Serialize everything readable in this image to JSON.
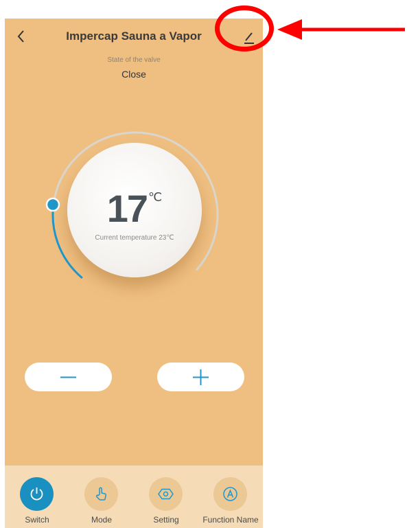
{
  "header": {
    "title": "Impercap Sauna a Vapor",
    "back_icon": "chevron-left-icon",
    "edit_icon": "pencil-icon"
  },
  "status": {
    "label": "State of the valve",
    "value": "Close"
  },
  "thermostat": {
    "set_temperature": "17",
    "unit": "℃",
    "current_temperature_text": "Current temperature 23℃",
    "accent_color": "#2196c9"
  },
  "controls": {
    "decrease_icon": "minus-icon",
    "increase_icon": "plus-icon"
  },
  "bottom_nav": {
    "items": [
      {
        "label": "Switch",
        "icon": "power-icon",
        "active": true
      },
      {
        "label": "Mode",
        "icon": "hand-pointer-icon",
        "active": false
      },
      {
        "label": "Setting",
        "icon": "hexagon-settings-icon",
        "active": false
      },
      {
        "label": "Function Name",
        "icon": "letter-a-circle-icon",
        "active": false
      }
    ]
  },
  "colors": {
    "background": "#efbf82",
    "bottom_bar": "#f5dcb7",
    "annotation": "#ff0000"
  }
}
